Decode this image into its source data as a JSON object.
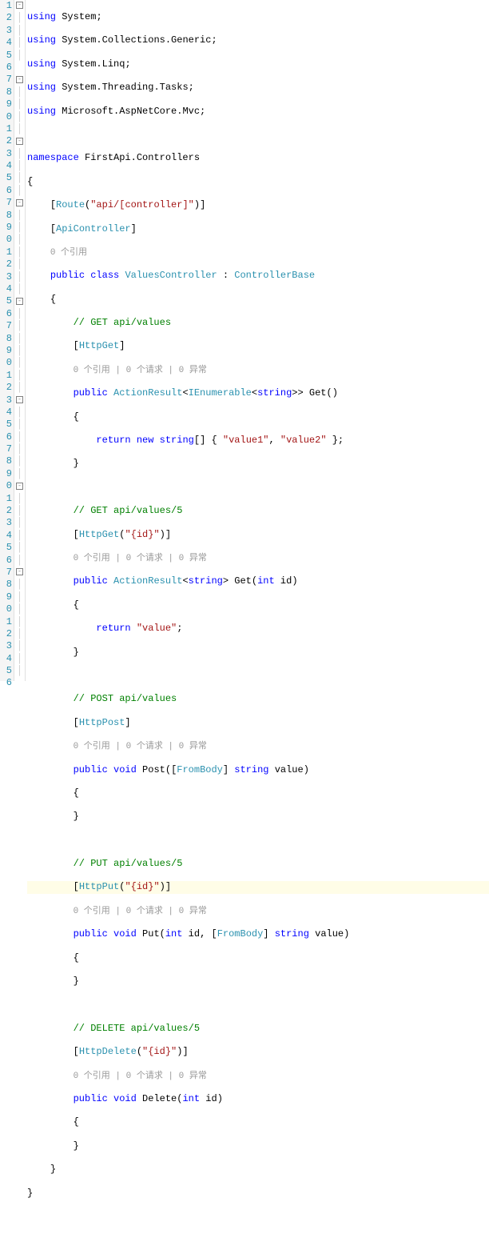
{
  "lineNumbers": [
    "1",
    "2",
    "3",
    "4",
    "5",
    "6",
    "7",
    "8",
    "9",
    "0",
    "1",
    "2",
    "3",
    "4",
    "5",
    "6",
    "7",
    "8",
    "9",
    "0",
    "1",
    "2",
    "3",
    "4",
    "5",
    "6",
    "7",
    "8",
    "9",
    "0",
    "1",
    "2",
    "3",
    "4",
    "5",
    "6",
    "7",
    "8",
    "9",
    "0",
    "1",
    "2",
    "3",
    "4",
    "5",
    "6",
    "7",
    "8",
    "9",
    "0",
    "1",
    "2",
    "3",
    "4",
    "5",
    "6"
  ],
  "code": {
    "using1": "using",
    "using2": "using",
    "using3": "using",
    "using4": "using",
    "using5": "using",
    "ns_System": "System",
    "ns_Collections": "System.Collections.Generic",
    "ns_Linq": "System.Linq",
    "ns_Tasks": "System.Threading.Tasks",
    "ns_Mvc": "Microsoft.AspNetCore.Mvc",
    "semi": ";",
    "namespace": "namespace",
    "nsName": "FirstApi.Controllers",
    "lbrace": "{",
    "rbrace": "}",
    "lbracket": "[",
    "rbracket": "]",
    "route": "Route",
    "routeArg": "\"api/[controller]\"",
    "apiController": "ApiController",
    "codelens1": "0 个引用",
    "codelens3": "0 个引用 | 0 个请求 | 0 异常",
    "public": "public",
    "class": "class",
    "className": "ValuesController",
    "colon": " : ",
    "baseClass": "ControllerBase",
    "c_get1": "// GET api/values",
    "httpGet": "HttpGet",
    "actionResult": "ActionResult",
    "ienum": "IEnumerable",
    "stringT": "string",
    "get": "Get",
    "return": "return",
    "new": "new",
    "arr_open": "[] { ",
    "val1": "\"value1\"",
    "comma": ", ",
    "val2": "\"value2\"",
    "arr_close": " }",
    "c_get2": "// GET api/values/5",
    "httpGetId": "\"{id}\"",
    "int": "int",
    "id": "id",
    "valueStr": "\"value\"",
    "c_post": "// POST api/values",
    "httpPost": "HttpPost",
    "void": "void",
    "post": "Post",
    "fromBody": "FromBody",
    "value": "value",
    "c_put": "// PUT api/values/5",
    "httpPut": "HttpPut",
    "put": "Put",
    "c_delete": "// DELETE api/values/5",
    "httpDelete": "HttpDelete",
    "delete": "Delete",
    "lparen": "(",
    "rparen": ")",
    "lt": "<",
    "gt": ">",
    "gtgt": ">>"
  }
}
